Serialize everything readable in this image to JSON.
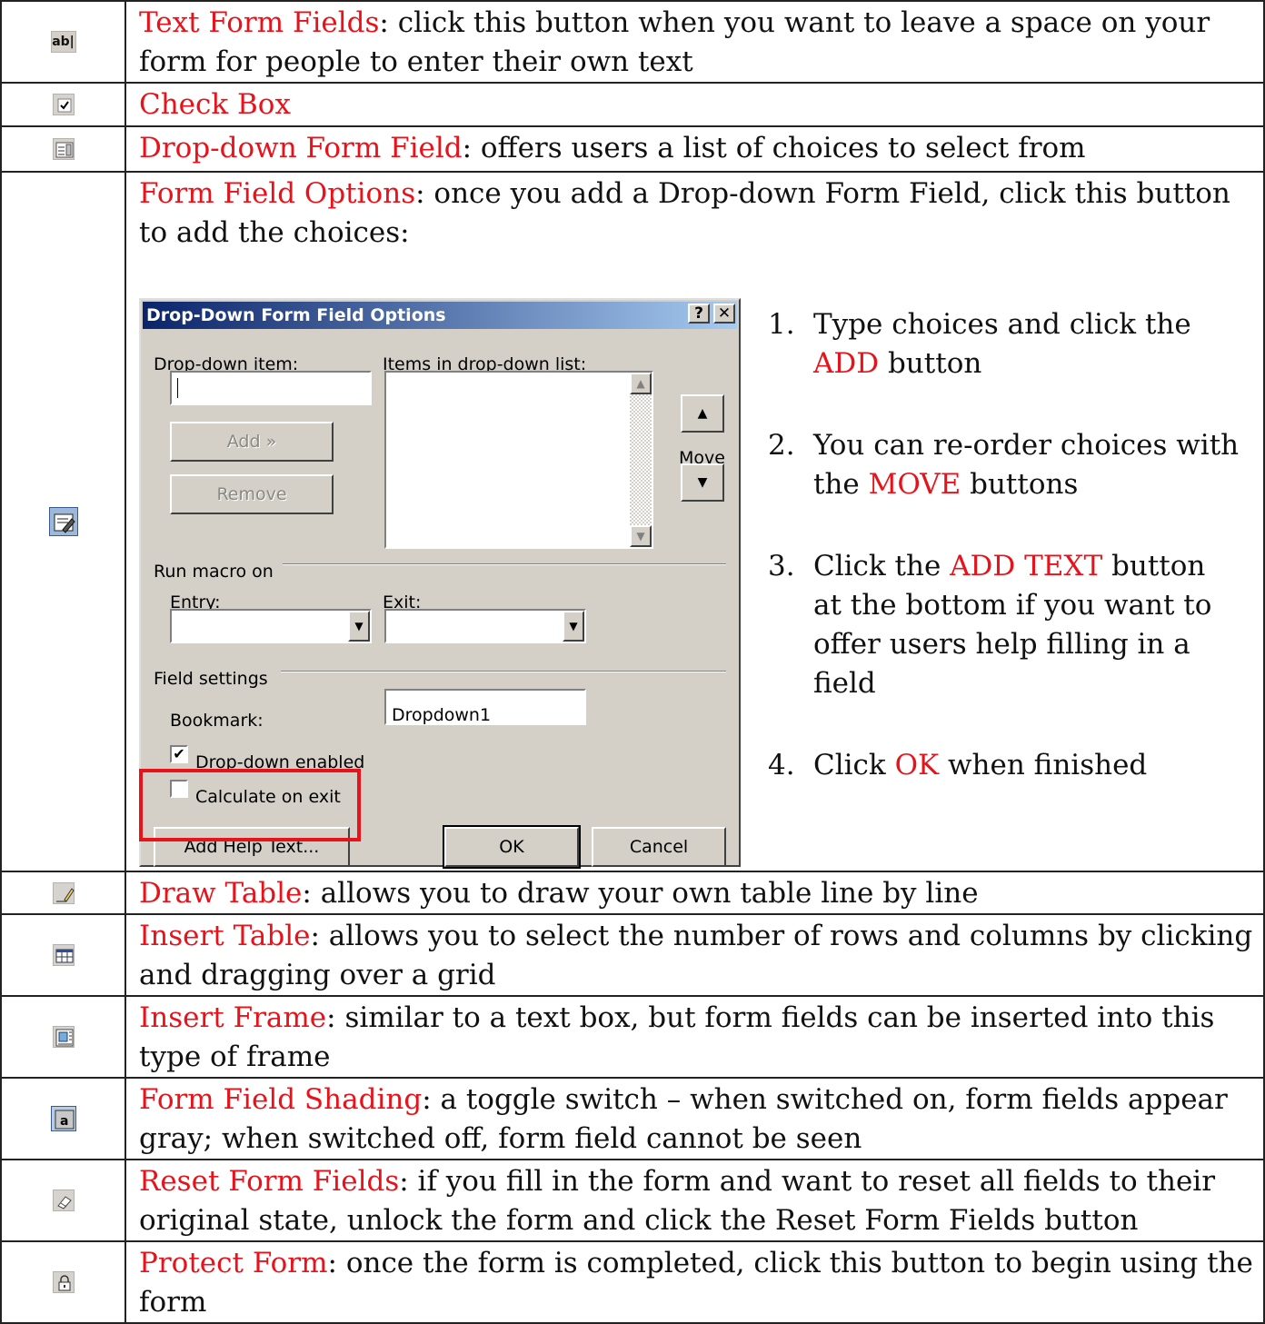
{
  "rows": [
    {
      "icon": "text-form-field-icon",
      "term": "Text Form Fields",
      "desc": ": click this button when you want to leave a space on your form for people to enter their own text"
    },
    {
      "icon": "check-box-icon",
      "term": "Check Box",
      "desc": ""
    },
    {
      "icon": "drop-down-field-icon",
      "term": "Drop-down Form Field",
      "desc": ": offers users a list of choices to select from"
    },
    {
      "icon": "form-field-options-icon",
      "term": "Form Field Options",
      "desc": ": once you add a Drop-down Form Field, click this button to add the choices:"
    },
    {
      "icon": "draw-table-icon",
      "term": "Draw Table",
      "desc": ": allows you to draw your own table line by line"
    },
    {
      "icon": "insert-table-icon",
      "term": "Insert Table",
      "desc": ": allows you to select the number of rows and columns by clicking and dragging over a grid"
    },
    {
      "icon": "insert-frame-icon",
      "term": "Insert Frame",
      "desc": ": similar to a text box, but form fields can be inserted into this type of frame"
    },
    {
      "icon": "form-field-shading-icon",
      "term": "Form Field Shading",
      "desc": ": a toggle switch – when switched on, form fields appear gray; when switched off, form field cannot be seen"
    },
    {
      "icon": "reset-form-fields-icon",
      "term": "Reset Form Fields",
      "desc": ": if you fill in the form and want to reset all fields to their original state, unlock the form and click the Reset Form Fields button"
    },
    {
      "icon": "protect-form-icon",
      "term": "Protect Form",
      "desc": ": once the form is completed, click this button to begin using the form"
    }
  ],
  "icon_glyphs": {
    "text_field": "ab|"
  },
  "dialog": {
    "title": "Drop-Down Form Field Options",
    "help_btn": "?",
    "close_btn": "✕",
    "dropdown_item_label": "Drop-down item:",
    "dropdown_item_value": "",
    "items_list_label": "Items in drop-down list:",
    "add_button": "Add »",
    "remove_button": "Remove",
    "move_label": "Move",
    "move_up": "▲",
    "move_down": "▼",
    "run_macro_label": "Run macro on",
    "entry_label": "Entry:",
    "exit_label": "Exit:",
    "field_settings_label": "Field settings",
    "bookmark_label": "Bookmark:",
    "bookmark_value": "Dropdown1",
    "dropdown_enabled_label": "Drop-down enabled",
    "dropdown_enabled_checked": true,
    "calculate_on_exit_label": "Calculate on exit",
    "calculate_on_exit_checked": false,
    "add_help_text_button": "Add Help Text...",
    "ok_button": "OK",
    "cancel_button": "Cancel",
    "check_mark": "✔",
    "combo_arrow": "▼"
  },
  "steps": [
    {
      "num": "1.",
      "parts": [
        {
          "t": "Type choices and click the "
        },
        {
          "t": "ADD",
          "red": true
        },
        {
          "t": " button"
        }
      ]
    },
    {
      "num": "2.",
      "parts": [
        {
          "t": "You can re-order choices with the "
        },
        {
          "t": "MOVE",
          "red": true
        },
        {
          "t": " buttons"
        }
      ]
    },
    {
      "num": "3.",
      "parts": [
        {
          "t": "Click the "
        },
        {
          "t": "ADD TEXT",
          "red": true
        },
        {
          "t": " button at the bottom if you want to offer users help filling in a field"
        }
      ]
    },
    {
      "num": "4.",
      "parts": [
        {
          "t": "Click "
        },
        {
          "t": "OK",
          "red": true
        },
        {
          "t": " when finished"
        }
      ]
    }
  ],
  "colors": {
    "term": "#e8121a",
    "highlight": "#e8121a",
    "titlebar": "#0a246a",
    "dialog_bg": "#d4d0c8"
  }
}
